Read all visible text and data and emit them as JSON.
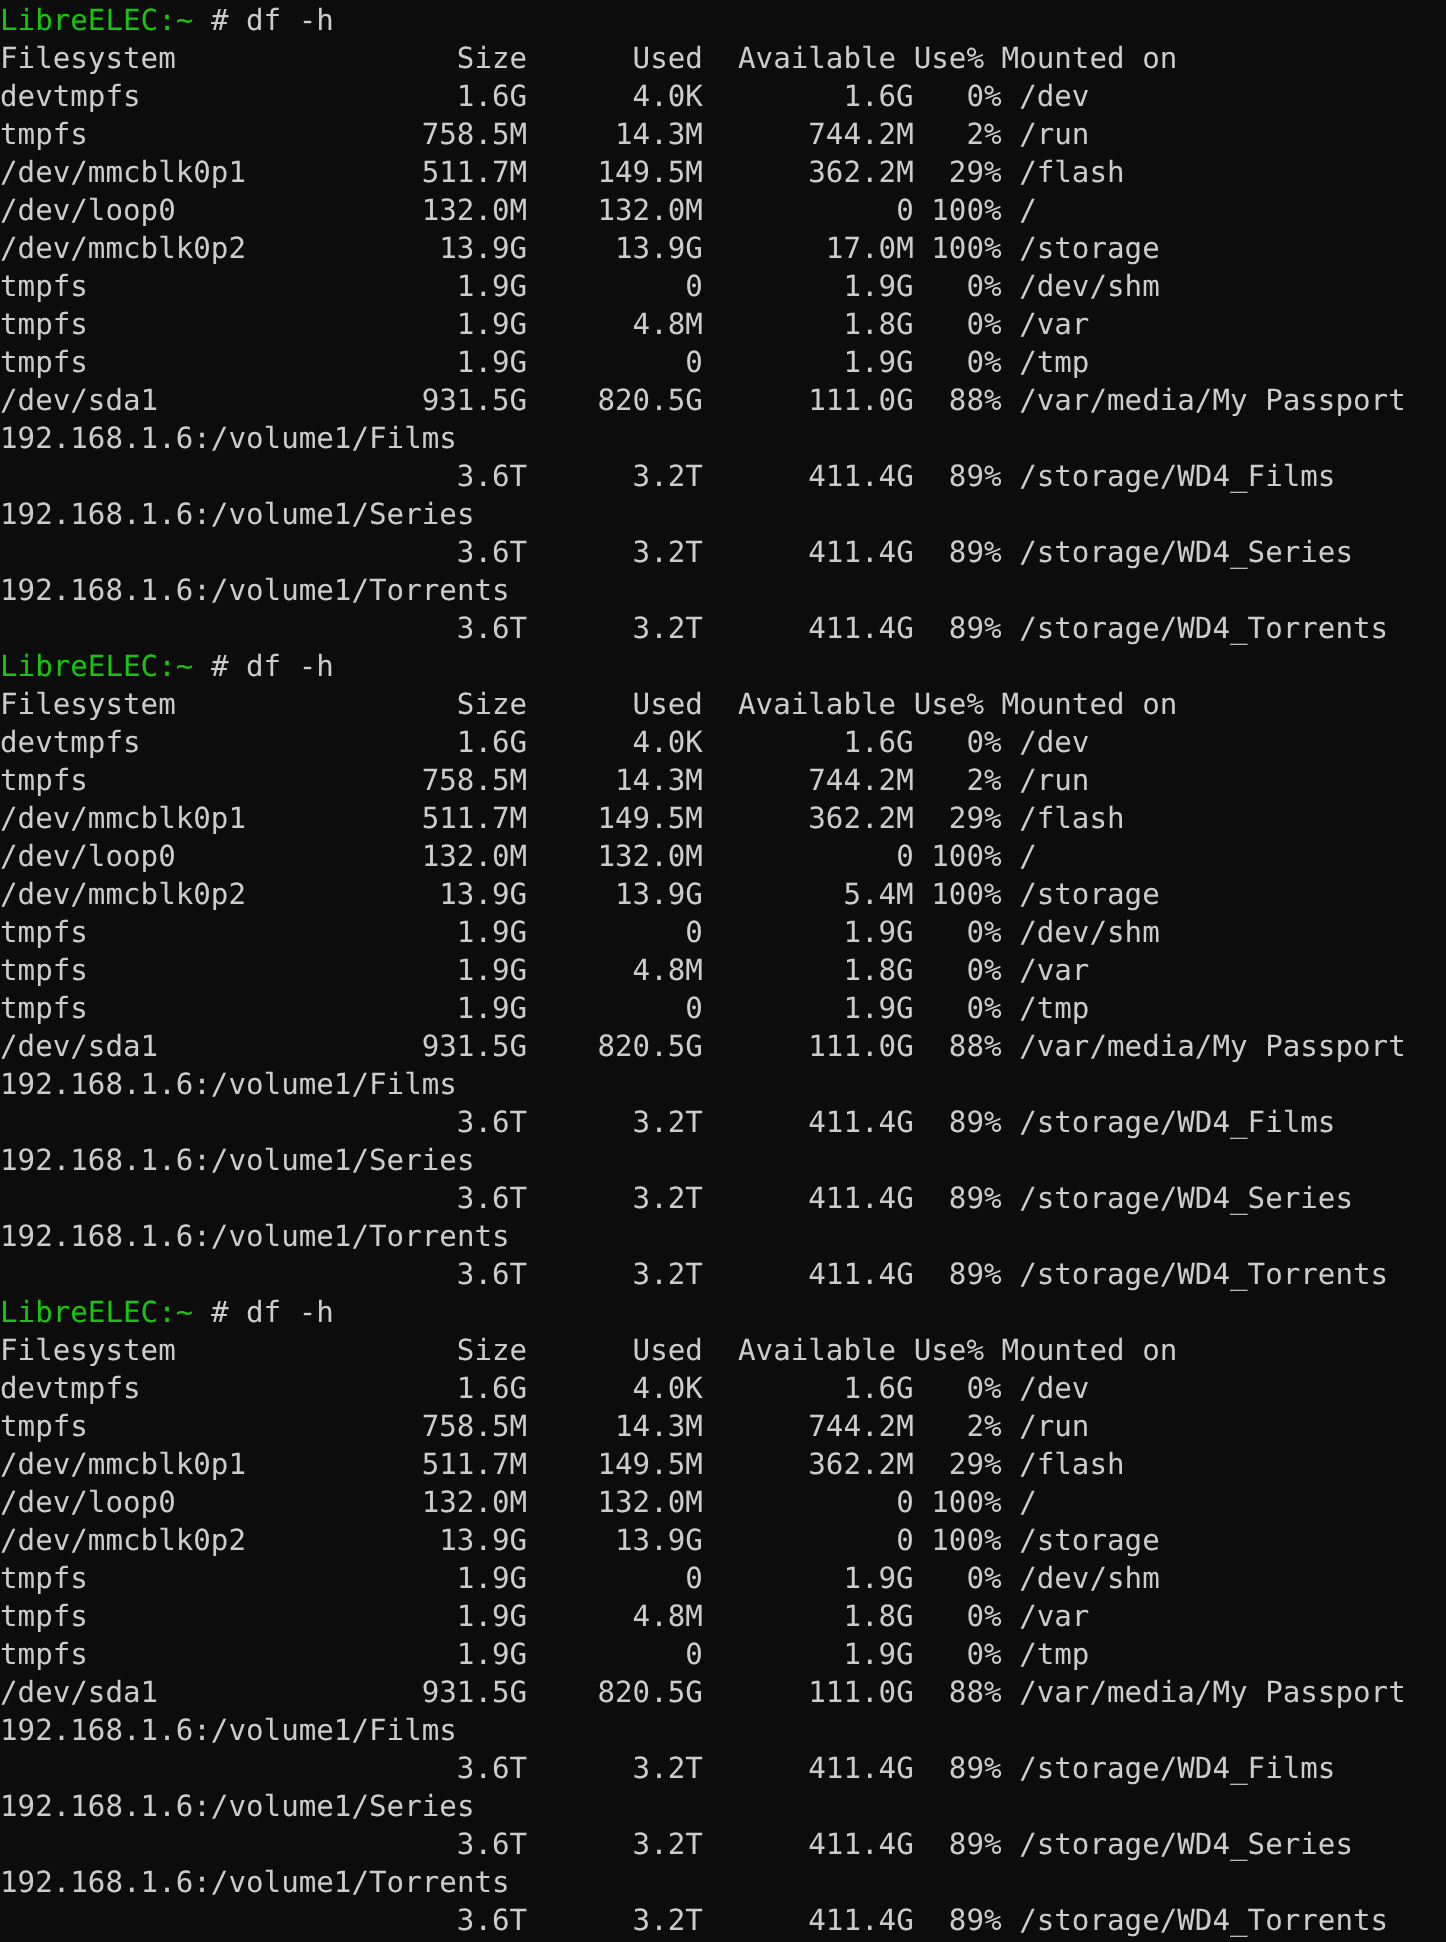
{
  "blocks": [
    {
      "prompt": "LibreELEC:~",
      "command": "# df -h",
      "header": {
        "filesystem": "Filesystem",
        "size": "Size",
        "used": "Used",
        "available": "Available",
        "use": "Use%",
        "mounted": "Mounted on"
      },
      "rows": [
        {
          "filesystem": "devtmpfs",
          "size": "1.6G",
          "used": "4.0K",
          "available": "1.6G",
          "use": "0%",
          "mounted": "/dev"
        },
        {
          "filesystem": "tmpfs",
          "size": "758.5M",
          "used": "14.3M",
          "available": "744.2M",
          "use": "2%",
          "mounted": "/run"
        },
        {
          "filesystem": "/dev/mmcblk0p1",
          "size": "511.7M",
          "used": "149.5M",
          "available": "362.2M",
          "use": "29%",
          "mounted": "/flash"
        },
        {
          "filesystem": "/dev/loop0",
          "size": "132.0M",
          "used": "132.0M",
          "available": "0",
          "use": "100%",
          "mounted": "/"
        },
        {
          "filesystem": "/dev/mmcblk0p2",
          "size": "13.9G",
          "used": "13.9G",
          "available": "17.0M",
          "use": "100%",
          "mounted": "/storage"
        },
        {
          "filesystem": "tmpfs",
          "size": "1.9G",
          "used": "0",
          "available": "1.9G",
          "use": "0%",
          "mounted": "/dev/shm"
        },
        {
          "filesystem": "tmpfs",
          "size": "1.9G",
          "used": "4.8M",
          "available": "1.8G",
          "use": "0%",
          "mounted": "/var"
        },
        {
          "filesystem": "tmpfs",
          "size": "1.9G",
          "used": "0",
          "available": "1.9G",
          "use": "0%",
          "mounted": "/tmp"
        },
        {
          "filesystem": "/dev/sda1",
          "size": "931.5G",
          "used": "820.5G",
          "available": "111.0G",
          "use": "88%",
          "mounted": "/var/media/My Passport"
        },
        {
          "filesystem": "192.168.1.6:/volume1/Films",
          "size": "3.6T",
          "used": "3.2T",
          "available": "411.4G",
          "use": "89%",
          "mounted": "/storage/WD4_Films"
        },
        {
          "filesystem": "192.168.1.6:/volume1/Series",
          "size": "3.6T",
          "used": "3.2T",
          "available": "411.4G",
          "use": "89%",
          "mounted": "/storage/WD4_Series"
        },
        {
          "filesystem": "192.168.1.6:/volume1/Torrents",
          "size": "3.6T",
          "used": "3.2T",
          "available": "411.4G",
          "use": "89%",
          "mounted": "/storage/WD4_Torrents"
        }
      ]
    },
    {
      "prompt": "LibreELEC:~",
      "command": "# df -h",
      "header": {
        "filesystem": "Filesystem",
        "size": "Size",
        "used": "Used",
        "available": "Available",
        "use": "Use%",
        "mounted": "Mounted on"
      },
      "rows": [
        {
          "filesystem": "devtmpfs",
          "size": "1.6G",
          "used": "4.0K",
          "available": "1.6G",
          "use": "0%",
          "mounted": "/dev"
        },
        {
          "filesystem": "tmpfs",
          "size": "758.5M",
          "used": "14.3M",
          "available": "744.2M",
          "use": "2%",
          "mounted": "/run"
        },
        {
          "filesystem": "/dev/mmcblk0p1",
          "size": "511.7M",
          "used": "149.5M",
          "available": "362.2M",
          "use": "29%",
          "mounted": "/flash"
        },
        {
          "filesystem": "/dev/loop0",
          "size": "132.0M",
          "used": "132.0M",
          "available": "0",
          "use": "100%",
          "mounted": "/"
        },
        {
          "filesystem": "/dev/mmcblk0p2",
          "size": "13.9G",
          "used": "13.9G",
          "available": "5.4M",
          "use": "100%",
          "mounted": "/storage"
        },
        {
          "filesystem": "tmpfs",
          "size": "1.9G",
          "used": "0",
          "available": "1.9G",
          "use": "0%",
          "mounted": "/dev/shm"
        },
        {
          "filesystem": "tmpfs",
          "size": "1.9G",
          "used": "4.8M",
          "available": "1.8G",
          "use": "0%",
          "mounted": "/var"
        },
        {
          "filesystem": "tmpfs",
          "size": "1.9G",
          "used": "0",
          "available": "1.9G",
          "use": "0%",
          "mounted": "/tmp"
        },
        {
          "filesystem": "/dev/sda1",
          "size": "931.5G",
          "used": "820.5G",
          "available": "111.0G",
          "use": "88%",
          "mounted": "/var/media/My Passport"
        },
        {
          "filesystem": "192.168.1.6:/volume1/Films",
          "size": "3.6T",
          "used": "3.2T",
          "available": "411.4G",
          "use": "89%",
          "mounted": "/storage/WD4_Films"
        },
        {
          "filesystem": "192.168.1.6:/volume1/Series",
          "size": "3.6T",
          "used": "3.2T",
          "available": "411.4G",
          "use": "89%",
          "mounted": "/storage/WD4_Series"
        },
        {
          "filesystem": "192.168.1.6:/volume1/Torrents",
          "size": "3.6T",
          "used": "3.2T",
          "available": "411.4G",
          "use": "89%",
          "mounted": "/storage/WD4_Torrents"
        }
      ]
    },
    {
      "prompt": "LibreELEC:~",
      "command": "# df -h",
      "header": {
        "filesystem": "Filesystem",
        "size": "Size",
        "used": "Used",
        "available": "Available",
        "use": "Use%",
        "mounted": "Mounted on"
      },
      "rows": [
        {
          "filesystem": "devtmpfs",
          "size": "1.6G",
          "used": "4.0K",
          "available": "1.6G",
          "use": "0%",
          "mounted": "/dev"
        },
        {
          "filesystem": "tmpfs",
          "size": "758.5M",
          "used": "14.3M",
          "available": "744.2M",
          "use": "2%",
          "mounted": "/run"
        },
        {
          "filesystem": "/dev/mmcblk0p1",
          "size": "511.7M",
          "used": "149.5M",
          "available": "362.2M",
          "use": "29%",
          "mounted": "/flash"
        },
        {
          "filesystem": "/dev/loop0",
          "size": "132.0M",
          "used": "132.0M",
          "available": "0",
          "use": "100%",
          "mounted": "/"
        },
        {
          "filesystem": "/dev/mmcblk0p2",
          "size": "13.9G",
          "used": "13.9G",
          "available": "0",
          "use": "100%",
          "mounted": "/storage"
        },
        {
          "filesystem": "tmpfs",
          "size": "1.9G",
          "used": "0",
          "available": "1.9G",
          "use": "0%",
          "mounted": "/dev/shm"
        },
        {
          "filesystem": "tmpfs",
          "size": "1.9G",
          "used": "4.8M",
          "available": "1.8G",
          "use": "0%",
          "mounted": "/var"
        },
        {
          "filesystem": "tmpfs",
          "size": "1.9G",
          "used": "0",
          "available": "1.9G",
          "use": "0%",
          "mounted": "/tmp"
        },
        {
          "filesystem": "/dev/sda1",
          "size": "931.5G",
          "used": "820.5G",
          "available": "111.0G",
          "use": "88%",
          "mounted": "/var/media/My Passport"
        },
        {
          "filesystem": "192.168.1.6:/volume1/Films",
          "size": "3.6T",
          "used": "3.2T",
          "available": "411.4G",
          "use": "89%",
          "mounted": "/storage/WD4_Films"
        },
        {
          "filesystem": "192.168.1.6:/volume1/Series",
          "size": "3.6T",
          "used": "3.2T",
          "available": "411.4G",
          "use": "89%",
          "mounted": "/storage/WD4_Series"
        },
        {
          "filesystem": "192.168.1.6:/volume1/Torrents",
          "size": "3.6T",
          "used": "3.2T",
          "available": "411.4G",
          "use": "89%",
          "mounted": "/storage/WD4_Torrents"
        }
      ]
    }
  ]
}
